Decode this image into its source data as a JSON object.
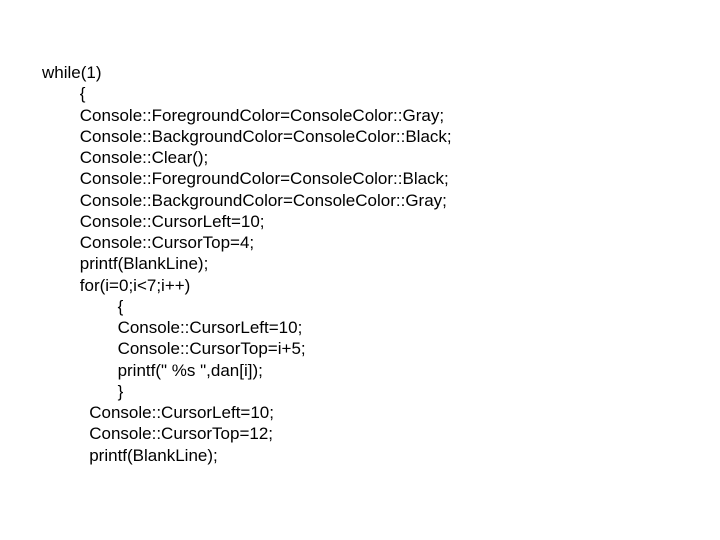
{
  "code": {
    "lines": [
      "while(1)",
      "        {",
      "        Console::ForegroundColor=ConsoleColor::Gray;",
      "        Console::BackgroundColor=ConsoleColor::Black;",
      "        Console::Clear();",
      "        Console::ForegroundColor=ConsoleColor::Black;",
      "        Console::BackgroundColor=ConsoleColor::Gray;",
      "        Console::CursorLeft=10;",
      "        Console::CursorTop=4;",
      "        printf(BlankLine);",
      "",
      "        for(i=0;i<7;i++)",
      "                {",
      "                Console::CursorLeft=10;",
      "                Console::CursorTop=i+5;",
      "                printf(\" %s \",dan[i]);",
      "                }",
      "          Console::CursorLeft=10;",
      "          Console::CursorTop=12;",
      "          printf(BlankLine);"
    ]
  }
}
